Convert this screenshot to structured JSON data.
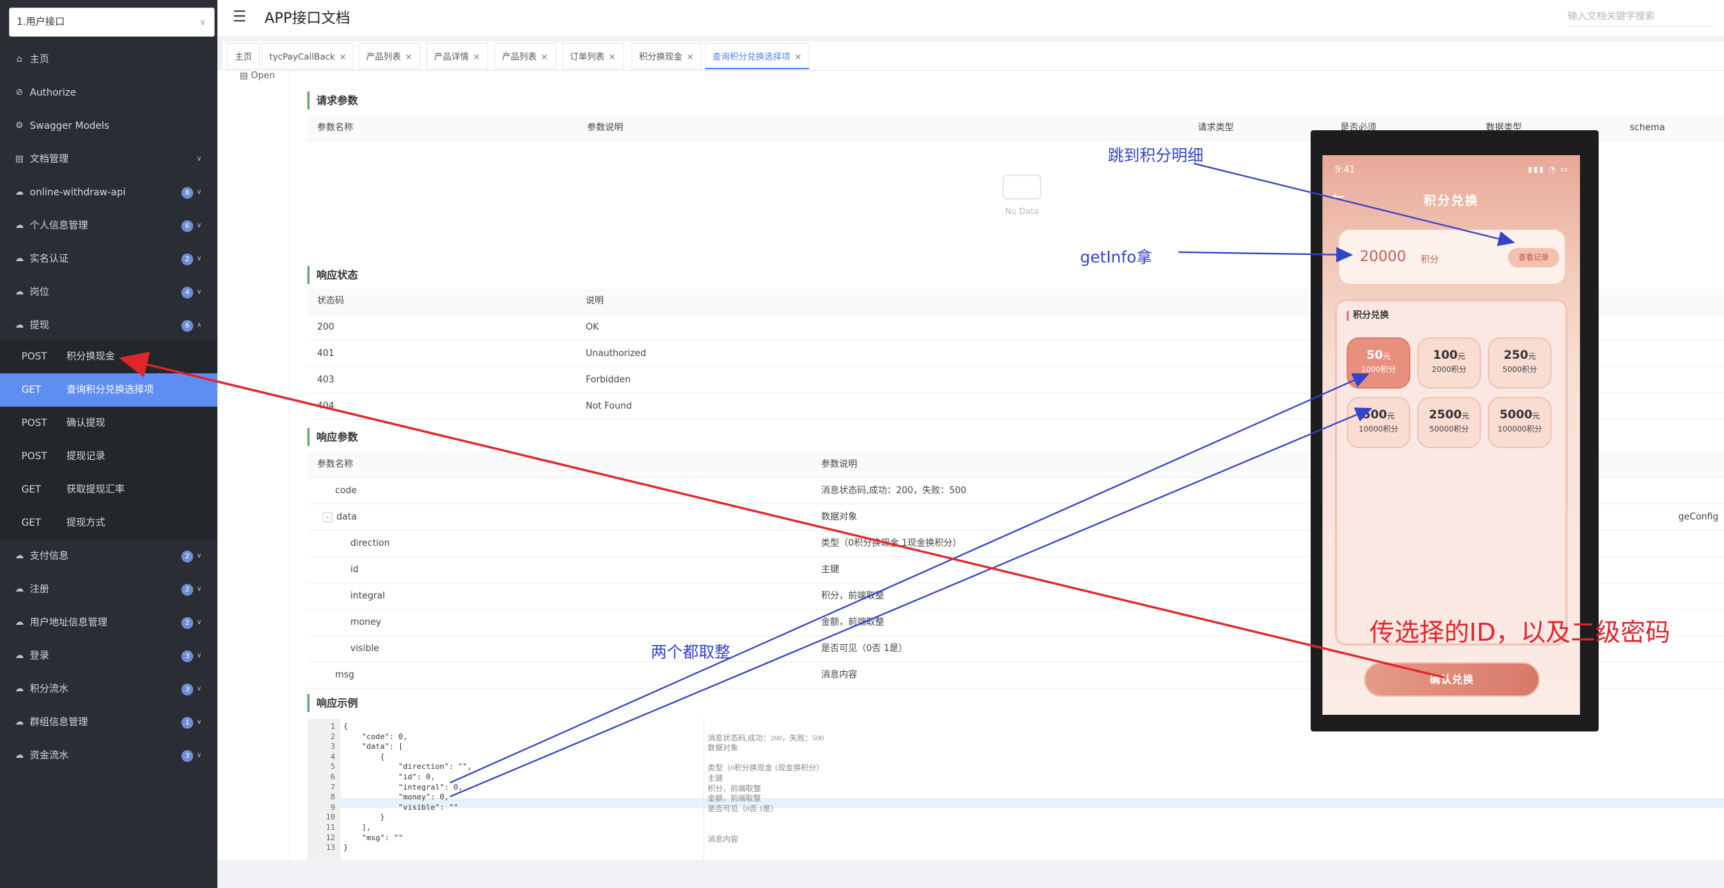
{
  "sidebar": {
    "group_select": "1.用户接口",
    "items": [
      {
        "label": "主页",
        "icon": "home-icon",
        "badge": ""
      },
      {
        "label": "Authorize",
        "icon": "lock-icon",
        "badge": ""
      },
      {
        "label": "Swagger Models",
        "icon": "models-icon",
        "badge": ""
      },
      {
        "label": "文档管理",
        "icon": "document-icon",
        "badge": ""
      },
      {
        "label": "online-withdraw-api",
        "icon": "cloud-icon",
        "badge": "8"
      },
      {
        "label": "个人信息管理",
        "icon": "cloud-icon",
        "badge": "6"
      },
      {
        "label": "实名认证",
        "icon": "cloud-icon",
        "badge": "2"
      },
      {
        "label": "岗位",
        "icon": "cloud-icon",
        "badge": "4"
      },
      {
        "label": "提现",
        "icon": "cloud-icon",
        "badge": "6"
      },
      {
        "label": "支付信息",
        "icon": "cloud-icon",
        "badge": "2"
      },
      {
        "label": "注册",
        "icon": "cloud-icon",
        "badge": "2"
      },
      {
        "label": "用户地址信息管理",
        "icon": "cloud-icon",
        "badge": "2"
      },
      {
        "label": "登录",
        "icon": "cloud-icon",
        "badge": "3"
      },
      {
        "label": "积分流水",
        "icon": "cloud-icon",
        "badge": "3"
      },
      {
        "label": "群组信息管理",
        "icon": "cloud-icon",
        "badge": "1"
      },
      {
        "label": "资金流水",
        "icon": "cloud-icon",
        "badge": "3"
      }
    ],
    "sub_items": [
      {
        "method": "POST",
        "label": "积分换现金"
      },
      {
        "method": "GET",
        "label": "查询积分兑换选择项"
      },
      {
        "method": "POST",
        "label": "确认提现"
      },
      {
        "method": "POST",
        "label": "提现记录"
      },
      {
        "method": "GET",
        "label": "获取提现汇率"
      },
      {
        "method": "GET",
        "label": "提现方式"
      }
    ]
  },
  "header": {
    "title": "APP接口文档",
    "search_placeholder": "输入文档关键字搜索"
  },
  "tabs": [
    {
      "label": "主页",
      "closable": false
    },
    {
      "label": "tycPayCallBack",
      "closable": true
    },
    {
      "label": "产品列表",
      "closable": true
    },
    {
      "label": "产品详情",
      "closable": true
    },
    {
      "label": "产品列表",
      "closable": true
    },
    {
      "label": "订单列表",
      "closable": true
    },
    {
      "label": "积分换现金",
      "closable": true
    },
    {
      "label": "查询积分兑换选择项",
      "closable": true
    }
  ],
  "close_glyph": "×",
  "main": {
    "open_link": "Open",
    "request_params": {
      "title": "请求参数",
      "headers": [
        "参数名称",
        "参数说明",
        "请求类型",
        "是否必须",
        "数据类型",
        "schema"
      ],
      "empty_text": "No Data"
    },
    "response_status": {
      "title": "响应状态",
      "headers": [
        "状态码",
        "说明"
      ],
      "rows": [
        {
          "code": "200",
          "desc": "OK"
        },
        {
          "code": "401",
          "desc": "Unauthorized"
        },
        {
          "code": "403",
          "desc": "Forbidden"
        },
        {
          "code": "404",
          "desc": "Not Found"
        }
      ]
    },
    "response_params": {
      "title": "响应参数",
      "headers": [
        "参数名称",
        "参数说明"
      ],
      "rows": [
        {
          "name": "code",
          "desc": "消息状态码,成功：200，失败：500",
          "expander": ""
        },
        {
          "name": "data",
          "desc": "数据对象",
          "expander": "-",
          "schema": "geConfig"
        },
        {
          "name": "direction",
          "desc": "类型（0积分换现金 1现金换积分）",
          "expander": ""
        },
        {
          "name": "id",
          "desc": "主键",
          "expander": ""
        },
        {
          "name": "integral",
          "desc": "积分，前端取整",
          "expander": ""
        },
        {
          "name": "money",
          "desc": "金额，前端取整",
          "expander": ""
        },
        {
          "name": "visible",
          "desc": "是否可见（0否 1是）",
          "expander": ""
        },
        {
          "name": "msg",
          "desc": "消息内容",
          "expander": ""
        }
      ]
    },
    "response_example": {
      "title": "响应示例",
      "lines": [
        {
          "n": "1",
          "code": "{",
          "comment": ""
        },
        {
          "n": "2",
          "code": "    \"code\": 0,",
          "comment": "消息状态码,成功：200，失败：500"
        },
        {
          "n": "3",
          "code": "    \"data\": [",
          "comment": "数据对象"
        },
        {
          "n": "4",
          "code": "        {",
          "comment": ""
        },
        {
          "n": "5",
          "code": "            \"direction\": \"\",",
          "comment": "类型（0积分换现金 1现金换积分）"
        },
        {
          "n": "6",
          "code": "            \"id\": 0,",
          "comment": "主键"
        },
        {
          "n": "7",
          "code": "            \"integral\": 0,",
          "comment": "积分，前端取整"
        },
        {
          "n": "8",
          "code": "            \"money\": 0,",
          "comment": "金额，前端取整"
        },
        {
          "n": "9",
          "code": "            \"visible\": \"\"",
          "comment": "是否可见（0否 1是）"
        },
        {
          "n": "10",
          "code": "        }",
          "comment": ""
        },
        {
          "n": "11",
          "code": "    ],",
          "comment": ""
        },
        {
          "n": "12",
          "code": "    \"msg\": \"\"",
          "comment": "消息内容"
        },
        {
          "n": "13",
          "code": "}",
          "comment": ""
        }
      ]
    }
  },
  "phone": {
    "time": "9:41",
    "title": "积分兑换",
    "points_value": "20000",
    "points_unit": "积分",
    "record_label": "查看记录",
    "exchange_title": "积分兑换",
    "options": [
      {
        "amount": "50",
        "unit": "元",
        "points": "1000积分",
        "selected": true
      },
      {
        "amount": "100",
        "unit": "元",
        "points": "2000积分",
        "selected": false
      },
      {
        "amount": "250",
        "unit": "元",
        "points": "5000积分",
        "selected": false
      },
      {
        "amount": "500",
        "unit": "元",
        "points": "10000积分",
        "selected": false
      },
      {
        "amount": "2500",
        "unit": "元",
        "points": "50000积分",
        "selected": false
      },
      {
        "amount": "5000",
        "unit": "元",
        "points": "100000积分",
        "selected": false
      }
    ],
    "confirm_label": "确认兑换"
  },
  "annotations": {
    "jump_detail": "跳到积分明细",
    "get_info": "getInfo拿",
    "both_round": "两个都取整",
    "pass_id": "传选择的ID，以及二级密码"
  },
  "colors": {
    "sidebar_bg": "#2a2d33",
    "active_item": "#5f8ef3",
    "annotation_blue": "#3443c8",
    "annotation_red": "#e0262c"
  }
}
